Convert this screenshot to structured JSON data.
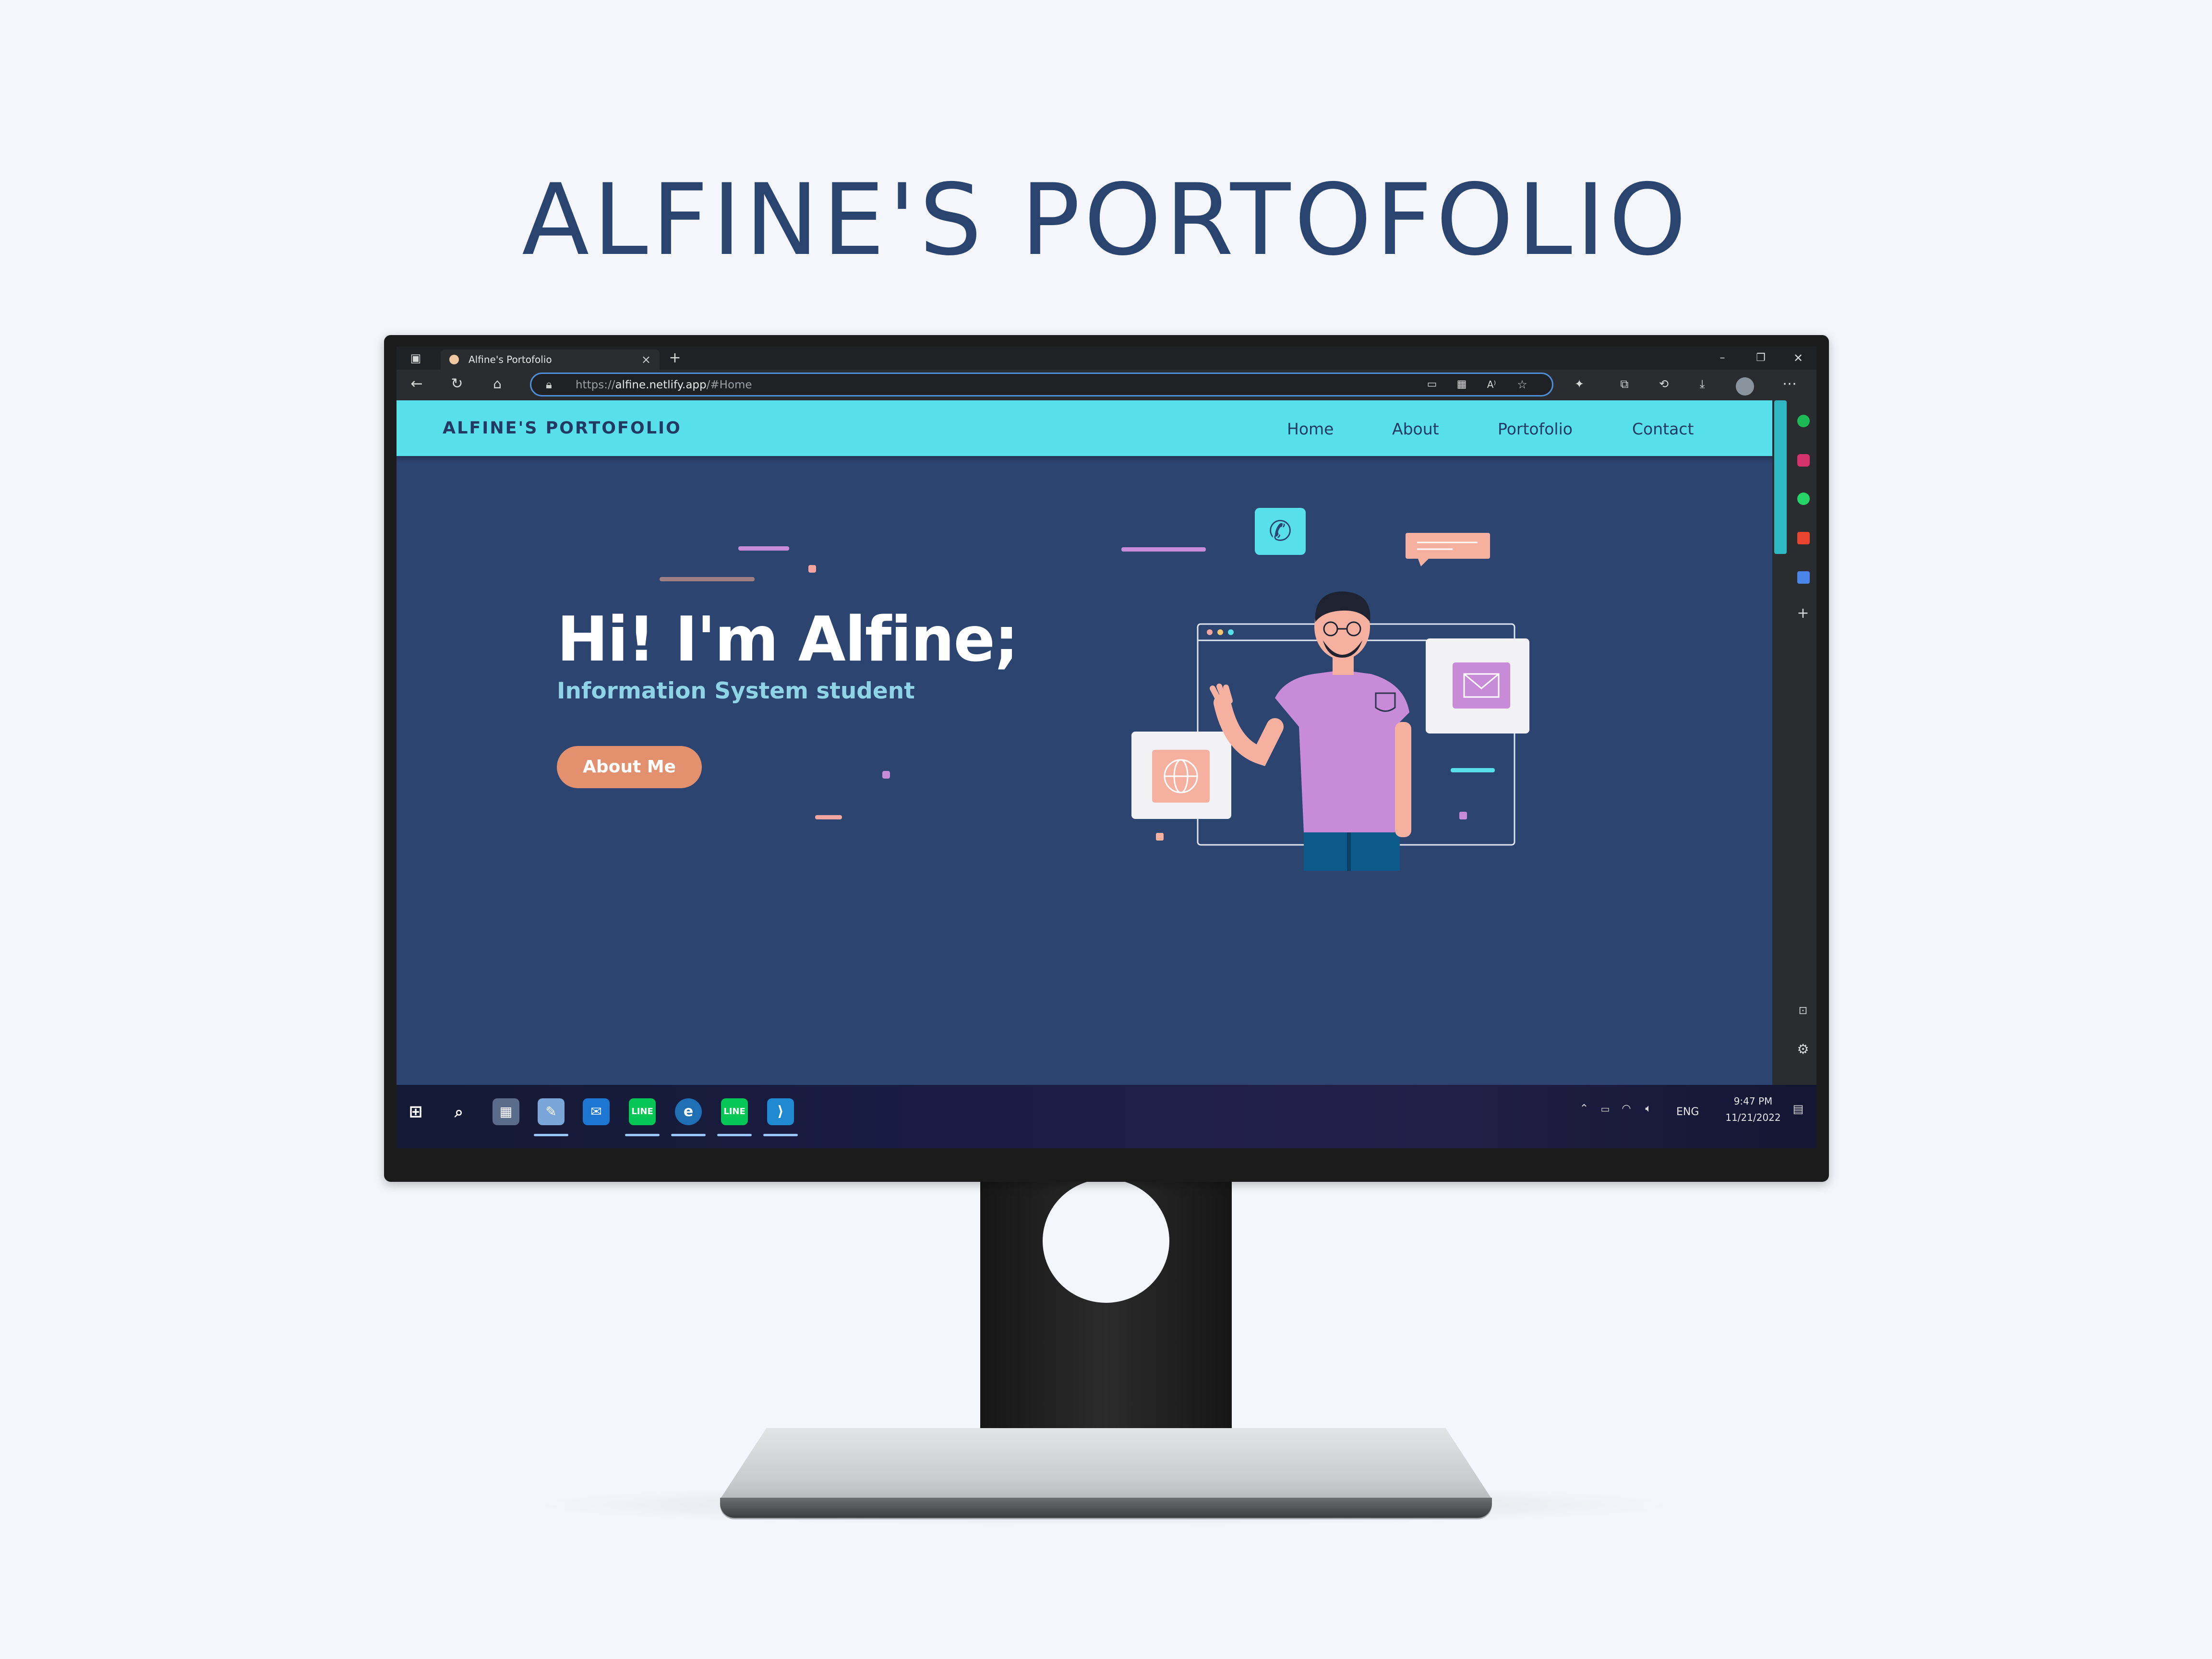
{
  "mockup": {
    "title": "ALFINE'S PORTOFOLIO"
  },
  "browser": {
    "tab_title": "Alfine's Portofolio",
    "tab_close": "×",
    "new_tab": "+",
    "url_scheme": "https://",
    "url_host": "alfine.netlify.app",
    "url_path": "/#Home",
    "window_controls": {
      "minimize": "–",
      "maximize": "❐",
      "close": "✕"
    },
    "more_menu": "⋯"
  },
  "site": {
    "brand": "ALFINE'S PORTOFOLIO",
    "nav": [
      {
        "label": "Home"
      },
      {
        "label": "About"
      },
      {
        "label": "Portofolio"
      },
      {
        "label": "Contact"
      }
    ],
    "hero": {
      "heading": "Hi! I'm Alfine;",
      "subtitle": "Information System student",
      "button": "About Me"
    }
  },
  "taskbar": {
    "language": "ENG",
    "time": "9:47 PM",
    "date": "11/21/2022"
  },
  "colors": {
    "nav_bg": "#58e0ea",
    "hero_bg": "#2c4470",
    "button_bg": "#e3906f",
    "subtitle": "#8fd3e8",
    "title_text": "#2a4470"
  }
}
